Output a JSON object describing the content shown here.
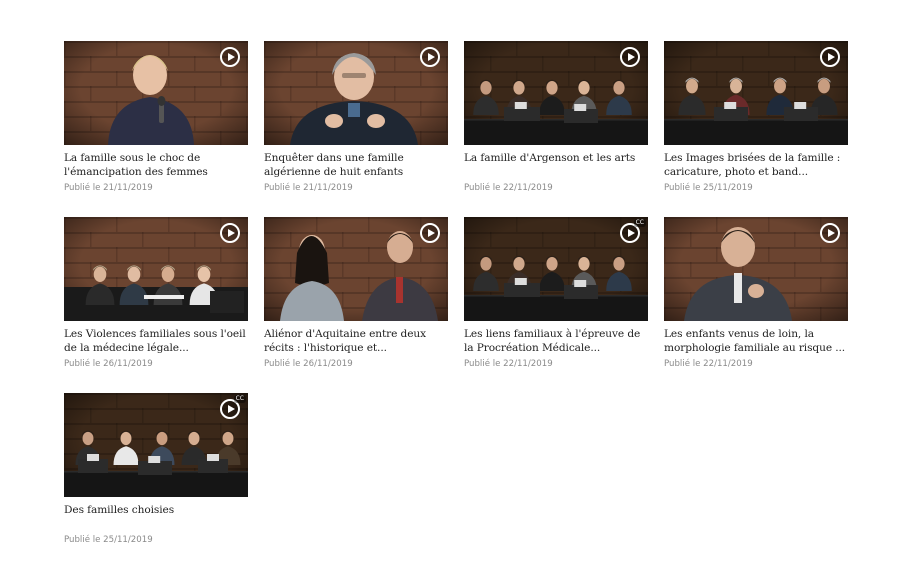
{
  "videos": [
    {
      "title": "La famille sous le choc de l'émancipation des femmes",
      "date": "Publié le 21/11/2019",
      "scene": "closeup-woman",
      "cc": false
    },
    {
      "title": "Enquêter dans une famille algérienne de huit enfants",
      "date": "Publié le 21/11/2019",
      "scene": "closeup-man-grey",
      "cc": false
    },
    {
      "title": "La famille d'Argenson et les arts",
      "date": "Publié le 22/11/2019",
      "scene": "panel-wide",
      "cc": false
    },
    {
      "title": "Les Images brisées de la famille : caricature, photo et band...",
      "date": "Publié le 25/11/2019",
      "scene": "panel-four",
      "cc": false
    },
    {
      "title": "Les Violences familiales sous l'oeil de la médecine légale...",
      "date": "Publié le 26/11/2019",
      "scene": "panel-table",
      "cc": false
    },
    {
      "title": "Aliénor d'Aquitaine entre deux récits : l'historique et...",
      "date": "Publié le 26/11/2019",
      "scene": "two-speakers",
      "cc": false
    },
    {
      "title": "Les liens familiaux à l'épreuve de la Procréation Médicale...",
      "date": "Publié le 22/11/2019",
      "scene": "panel-wide",
      "cc": true
    },
    {
      "title": "Les enfants venus de loin, la morphologie familiale au risque ...",
      "date": "Publié le 22/11/2019",
      "scene": "closeup-man",
      "cc": false
    },
    {
      "title": "Des familles choisies",
      "date": "Publié le 25/11/2019",
      "scene": "panel-five",
      "cc": true
    }
  ],
  "labels": {
    "play_icon": "play-circle-icon",
    "cc_text": "CC"
  },
  "colors": {
    "title": "#222222",
    "date": "#8a8a8a",
    "wood": "#7a4f33"
  }
}
